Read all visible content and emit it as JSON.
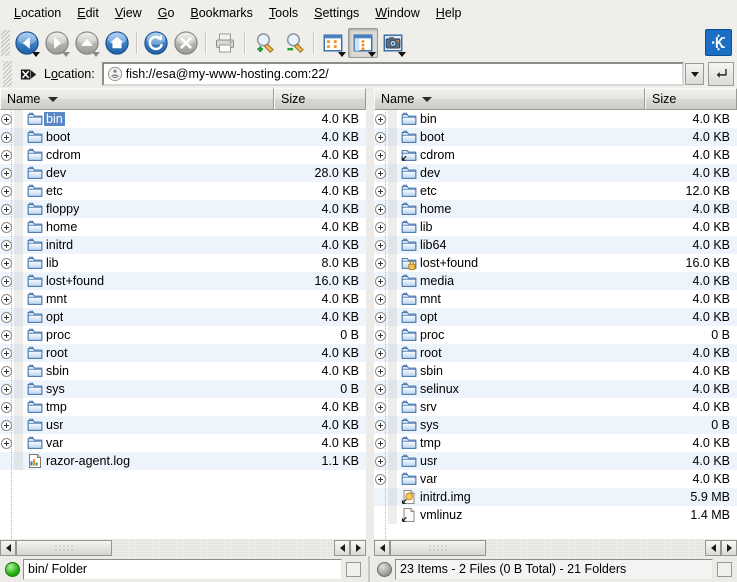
{
  "app": {
    "title": "Konqueror",
    "logo_icon": "kde-logo-icon"
  },
  "menubar": {
    "items": [
      {
        "label": "Location",
        "accel": "L"
      },
      {
        "label": "Edit",
        "accel": "E"
      },
      {
        "label": "View",
        "accel": "V"
      },
      {
        "label": "Go",
        "accel": "G"
      },
      {
        "label": "Bookmarks",
        "accel": "B"
      },
      {
        "label": "Tools",
        "accel": "T"
      },
      {
        "label": "Settings",
        "accel": "S"
      },
      {
        "label": "Window",
        "accel": "W"
      },
      {
        "label": "Help",
        "accel": "H"
      }
    ]
  },
  "toolbar": {
    "buttons": [
      {
        "name": "back-button",
        "icon": "arrow-left-icon",
        "enabled": true,
        "has_menu": true
      },
      {
        "name": "forward-button",
        "icon": "arrow-right-icon",
        "enabled": false,
        "has_menu": true
      },
      {
        "name": "up-button",
        "icon": "arrow-up-icon",
        "enabled": false,
        "has_menu": true
      },
      {
        "name": "home-button",
        "icon": "home-icon",
        "enabled": true,
        "has_menu": false
      },
      {
        "name": "reload-button",
        "icon": "reload-icon",
        "enabled": true,
        "has_menu": false
      },
      {
        "name": "stop-button",
        "icon": "stop-icon",
        "enabled": false,
        "has_menu": false
      },
      {
        "name": "print-button",
        "icon": "printer-icon",
        "enabled": false,
        "has_menu": false
      },
      {
        "name": "zoom-in-button",
        "icon": "magnifier-plus-icon",
        "enabled": true,
        "has_menu": false
      },
      {
        "name": "zoom-out-button",
        "icon": "magnifier-minus-icon",
        "enabled": true,
        "has_menu": false
      },
      {
        "name": "icon-view-button",
        "icon": "icon-view-icon",
        "enabled": true,
        "has_menu": true,
        "pressed": false
      },
      {
        "name": "tree-view-button",
        "icon": "tree-view-icon",
        "enabled": true,
        "has_menu": true,
        "pressed": true
      },
      {
        "name": "preview-button",
        "icon": "camera-icon",
        "enabled": true,
        "has_menu": true,
        "pressed": false
      }
    ]
  },
  "location": {
    "clear_icon": "clear-x-icon",
    "label": "Location:",
    "label_accel": "o",
    "protocol_icon": "network-icon",
    "value": "fish://esa@my-www-hosting.com:22/",
    "dropdown_icon": "chevron-down-icon",
    "go_icon": "enter-key-icon"
  },
  "columns": {
    "name": "Name",
    "size": "Size",
    "sort_icon": "sort-descending-icon"
  },
  "left_pane": {
    "rows": [
      {
        "name": "bin",
        "size": "4.0 KB",
        "icon": "folder-icon",
        "expandable": true,
        "selected": true
      },
      {
        "name": "boot",
        "size": "4.0 KB",
        "icon": "folder-icon",
        "expandable": true,
        "selected": false
      },
      {
        "name": "cdrom",
        "size": "4.0 KB",
        "icon": "folder-icon",
        "expandable": true,
        "selected": false
      },
      {
        "name": "dev",
        "size": "28.0 KB",
        "icon": "folder-icon",
        "expandable": true,
        "selected": false
      },
      {
        "name": "etc",
        "size": "4.0 KB",
        "icon": "folder-icon",
        "expandable": true,
        "selected": false
      },
      {
        "name": "floppy",
        "size": "4.0 KB",
        "icon": "folder-icon",
        "expandable": true,
        "selected": false
      },
      {
        "name": "home",
        "size": "4.0 KB",
        "icon": "folder-icon",
        "expandable": true,
        "selected": false
      },
      {
        "name": "initrd",
        "size": "4.0 KB",
        "icon": "folder-icon",
        "expandable": true,
        "selected": false
      },
      {
        "name": "lib",
        "size": "8.0 KB",
        "icon": "folder-icon",
        "expandable": true,
        "selected": false
      },
      {
        "name": "lost+found",
        "size": "16.0 KB",
        "icon": "folder-icon",
        "expandable": true,
        "selected": false
      },
      {
        "name": "mnt",
        "size": "4.0 KB",
        "icon": "folder-icon",
        "expandable": true,
        "selected": false
      },
      {
        "name": "opt",
        "size": "4.0 KB",
        "icon": "folder-icon",
        "expandable": true,
        "selected": false
      },
      {
        "name": "proc",
        "size": "0 B",
        "icon": "folder-icon",
        "expandable": true,
        "selected": false
      },
      {
        "name": "root",
        "size": "4.0 KB",
        "icon": "folder-icon",
        "expandable": true,
        "selected": false
      },
      {
        "name": "sbin",
        "size": "4.0 KB",
        "icon": "folder-icon",
        "expandable": true,
        "selected": false
      },
      {
        "name": "sys",
        "size": "0 B",
        "icon": "folder-icon",
        "expandable": true,
        "selected": false
      },
      {
        "name": "tmp",
        "size": "4.0 KB",
        "icon": "folder-icon",
        "expandable": true,
        "selected": false
      },
      {
        "name": "usr",
        "size": "4.0 KB",
        "icon": "folder-icon",
        "expandable": true,
        "selected": false
      },
      {
        "name": "var",
        "size": "4.0 KB",
        "icon": "folder-icon",
        "expandable": true,
        "selected": false
      },
      {
        "name": "razor-agent.log",
        "size": "1.1 KB",
        "icon": "log-file-icon",
        "expandable": false,
        "selected": false
      }
    ],
    "hscroll": {
      "left_arrow": "arrow-left-icon",
      "right_arrow": "arrow-right-icon",
      "thumb_position": 0
    },
    "status": {
      "led": "green",
      "text": "bin/  Folder"
    }
  },
  "right_pane": {
    "rows": [
      {
        "name": "bin",
        "size": "4.0 KB",
        "icon": "folder-icon",
        "expandable": true,
        "selected": false
      },
      {
        "name": "boot",
        "size": "4.0 KB",
        "icon": "folder-icon",
        "expandable": true,
        "selected": false
      },
      {
        "name": "cdrom",
        "size": "4.0 KB",
        "icon": "folder-link-icon",
        "expandable": true,
        "selected": false
      },
      {
        "name": "dev",
        "size": "4.0 KB",
        "icon": "folder-icon",
        "expandable": true,
        "selected": false
      },
      {
        "name": "etc",
        "size": "12.0 KB",
        "icon": "folder-icon",
        "expandable": true,
        "selected": false
      },
      {
        "name": "home",
        "size": "4.0 KB",
        "icon": "folder-icon",
        "expandable": true,
        "selected": false
      },
      {
        "name": "lib",
        "size": "4.0 KB",
        "icon": "folder-icon",
        "expandable": true,
        "selected": false
      },
      {
        "name": "lib64",
        "size": "4.0 KB",
        "icon": "folder-icon",
        "expandable": true,
        "selected": false
      },
      {
        "name": "lost+found",
        "size": "16.0 KB",
        "icon": "folder-locked-icon",
        "expandable": true,
        "selected": false
      },
      {
        "name": "media",
        "size": "4.0 KB",
        "icon": "folder-icon",
        "expandable": true,
        "selected": false
      },
      {
        "name": "mnt",
        "size": "4.0 KB",
        "icon": "folder-icon",
        "expandable": true,
        "selected": false
      },
      {
        "name": "opt",
        "size": "4.0 KB",
        "icon": "folder-icon",
        "expandable": true,
        "selected": false
      },
      {
        "name": "proc",
        "size": "0 B",
        "icon": "folder-icon",
        "expandable": true,
        "selected": false
      },
      {
        "name": "root",
        "size": "4.0 KB",
        "icon": "folder-icon",
        "expandable": true,
        "selected": false
      },
      {
        "name": "sbin",
        "size": "4.0 KB",
        "icon": "folder-icon",
        "expandable": true,
        "selected": false
      },
      {
        "name": "selinux",
        "size": "4.0 KB",
        "icon": "folder-icon",
        "expandable": true,
        "selected": false
      },
      {
        "name": "srv",
        "size": "4.0 KB",
        "icon": "folder-icon",
        "expandable": true,
        "selected": false
      },
      {
        "name": "sys",
        "size": "0 B",
        "icon": "folder-icon",
        "expandable": true,
        "selected": false
      },
      {
        "name": "tmp",
        "size": "4.0 KB",
        "icon": "folder-icon",
        "expandable": true,
        "selected": false
      },
      {
        "name": "usr",
        "size": "4.0 KB",
        "icon": "folder-icon",
        "expandable": true,
        "selected": false
      },
      {
        "name": "var",
        "size": "4.0 KB",
        "icon": "folder-icon",
        "expandable": true,
        "selected": false
      },
      {
        "name": "initrd.img",
        "size": "5.9 MB",
        "icon": "file-link-icon",
        "expandable": false,
        "selected": false
      },
      {
        "name": "vmlinuz",
        "size": "1.4 MB",
        "icon": "file-link-icon",
        "expandable": false,
        "selected": false
      }
    ],
    "hscroll": {
      "left_arrow": "arrow-left-icon",
      "right_arrow": "arrow-right-icon",
      "thumb_position": 0
    },
    "status": {
      "led": "gray",
      "text": "23 Items - 2 Files (0 B Total) - 21 Folders"
    }
  },
  "colors": {
    "selection": "#5a87c8",
    "row_alt": "#eef4fb",
    "chrome": "#edebe7",
    "folder_blue": "#4a82c4",
    "accent": "#1a6fc4"
  }
}
